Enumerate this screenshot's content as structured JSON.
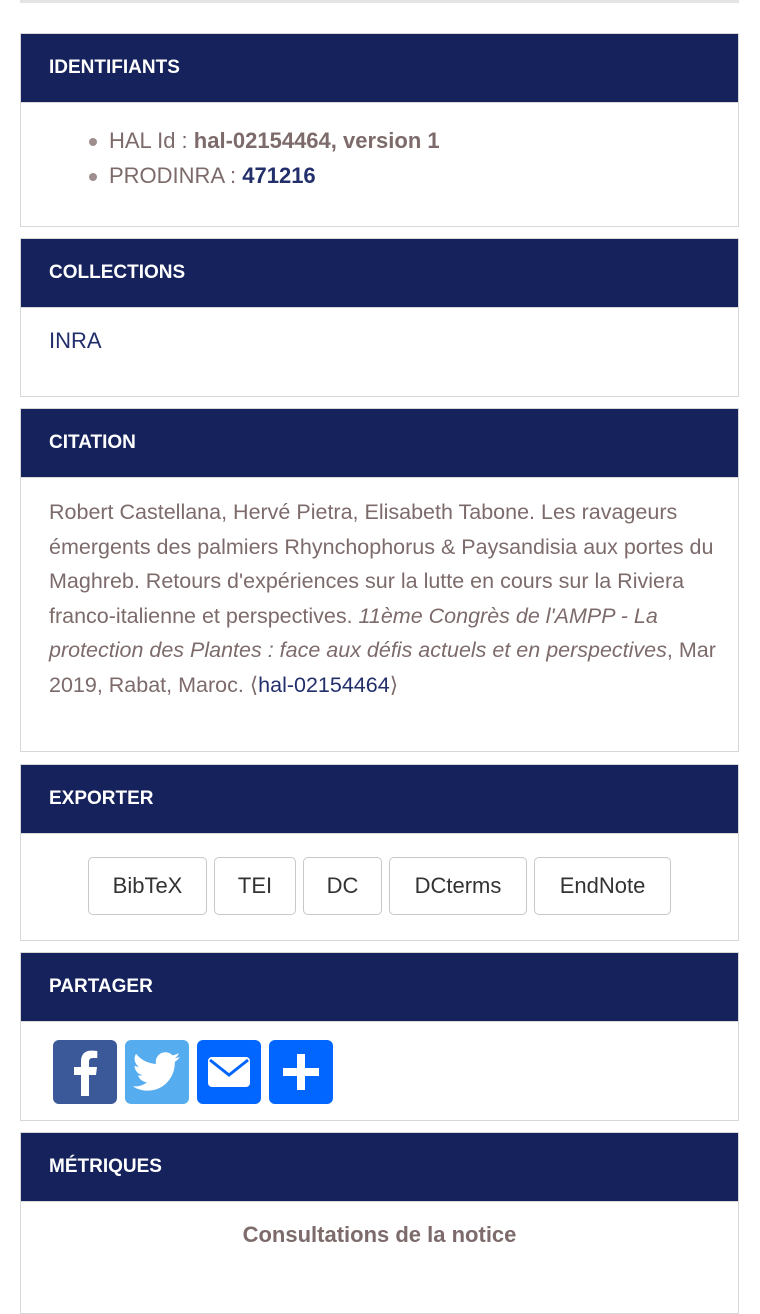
{
  "identifiants": {
    "heading": "IDENTIFIANTS",
    "items": [
      {
        "label": "HAL Id : ",
        "value": "hal-02154464, version 1"
      },
      {
        "label": "PRODINRA : ",
        "value": "471216"
      }
    ]
  },
  "collections": {
    "heading": "COLLECTIONS",
    "items": [
      "INRA"
    ]
  },
  "citation": {
    "heading": "CITATION",
    "text_before": "Robert Castellana, Hervé Pietra, Elisabeth Tabone. Les ravageurs émergents des palmiers Rhynchophorus & Paysandisia aux portes du Maghreb. Retours d'expériences sur la lutte en cours sur la Riviera franco-italienne et perspectives. ",
    "event_italic": "11ème Congrès de l'AMPP - La protection des Plantes : face aux défis actuels et en perspectives",
    "text_after": ", Mar 2019, Rabat, Maroc. ",
    "ref_open": "⟨",
    "ref_link": "hal-02154464",
    "ref_close": "⟩"
  },
  "exporter": {
    "heading": "EXPORTER",
    "buttons": [
      "BibTeX",
      "TEI",
      "DC",
      "DCterms",
      "EndNote"
    ]
  },
  "partager": {
    "heading": "PARTAGER",
    "buttons": [
      {
        "icon": "facebook-icon",
        "color": "#3b5998"
      },
      {
        "icon": "twitter-icon",
        "color": "#55acee"
      },
      {
        "icon": "email-icon",
        "color": "#0166ff"
      },
      {
        "icon": "plus-icon",
        "color": "#0166ff"
      }
    ]
  },
  "metriques": {
    "heading": "MÉTRIQUES",
    "subtitle": "Consultations de la notice"
  },
  "colors": {
    "header_bg": "#15225c",
    "text": "#7d6b6b",
    "link": "#222f6b"
  }
}
